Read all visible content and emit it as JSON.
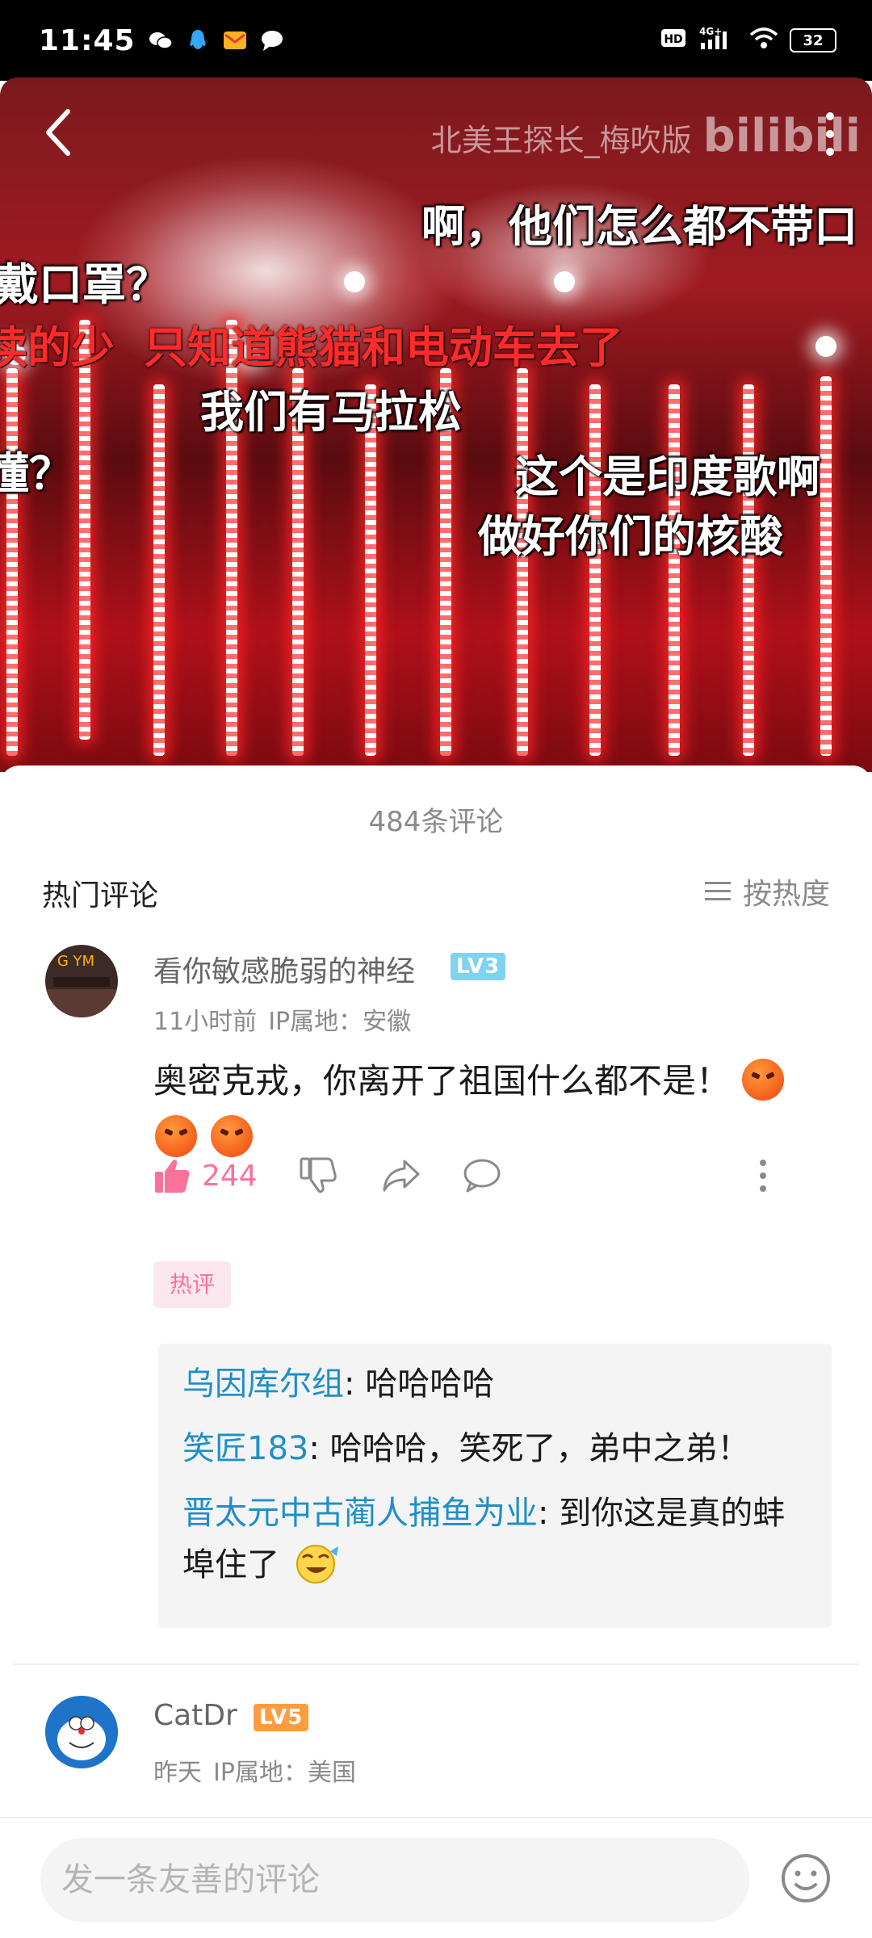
{
  "status_bar": {
    "time": "11:45",
    "network": "4G+",
    "battery": "32",
    "left_icons": [
      "wechat-icon",
      "qq-icon",
      "mail-icon",
      "message-icon"
    ],
    "right_icons": [
      "hd-icon",
      "signal-icon",
      "wifi-icon",
      "battery-icon"
    ]
  },
  "video": {
    "watermark_text": "北美王探长_梅吹版",
    "watermark_brand": "bilibili",
    "danmaku": [
      "啊，他们怎么都不带口",
      "戴口罩？",
      "读的少",
      "只知道熊猫和电动车去了",
      "我们有马拉松",
      "懂？",
      "这个是印度歌啊",
      "做好你们的核酸"
    ]
  },
  "comments_header": {
    "count_label": "484条评论",
    "section_title": "热门评论",
    "sort_label": "按热度"
  },
  "comments": [
    {
      "username": "看你敏感脆弱的神经",
      "level": "LV3",
      "level_color": "#7dd3f0",
      "time": "11小时前",
      "ip": "IP属地：安徽",
      "text": "奥密克戎，你离开了祖国什么都不是！",
      "like_count": "244",
      "tag": "热评",
      "replies": [
        {
          "user": "乌因库尔组",
          "text": ": 哈哈哈哈"
        },
        {
          "user": "笑匠183",
          "text": ": 哈哈哈，笑死了，弟中之弟！"
        },
        {
          "user": "晋太元中古蔺人捕鱼为业",
          "text": ": 到你这是真的蚌埠住了"
        }
      ]
    },
    {
      "username": "CatDr",
      "level": "LV5",
      "level_color": "#ff9c40",
      "time": "昨天",
      "ip": "IP属地：美国"
    }
  ],
  "input": {
    "placeholder": "发一条友善的评论"
  },
  "colors": {
    "accent_pink": "#fb7299",
    "reply_user_blue": "#1e8fc8",
    "meta_gray": "#8a8a8a"
  }
}
